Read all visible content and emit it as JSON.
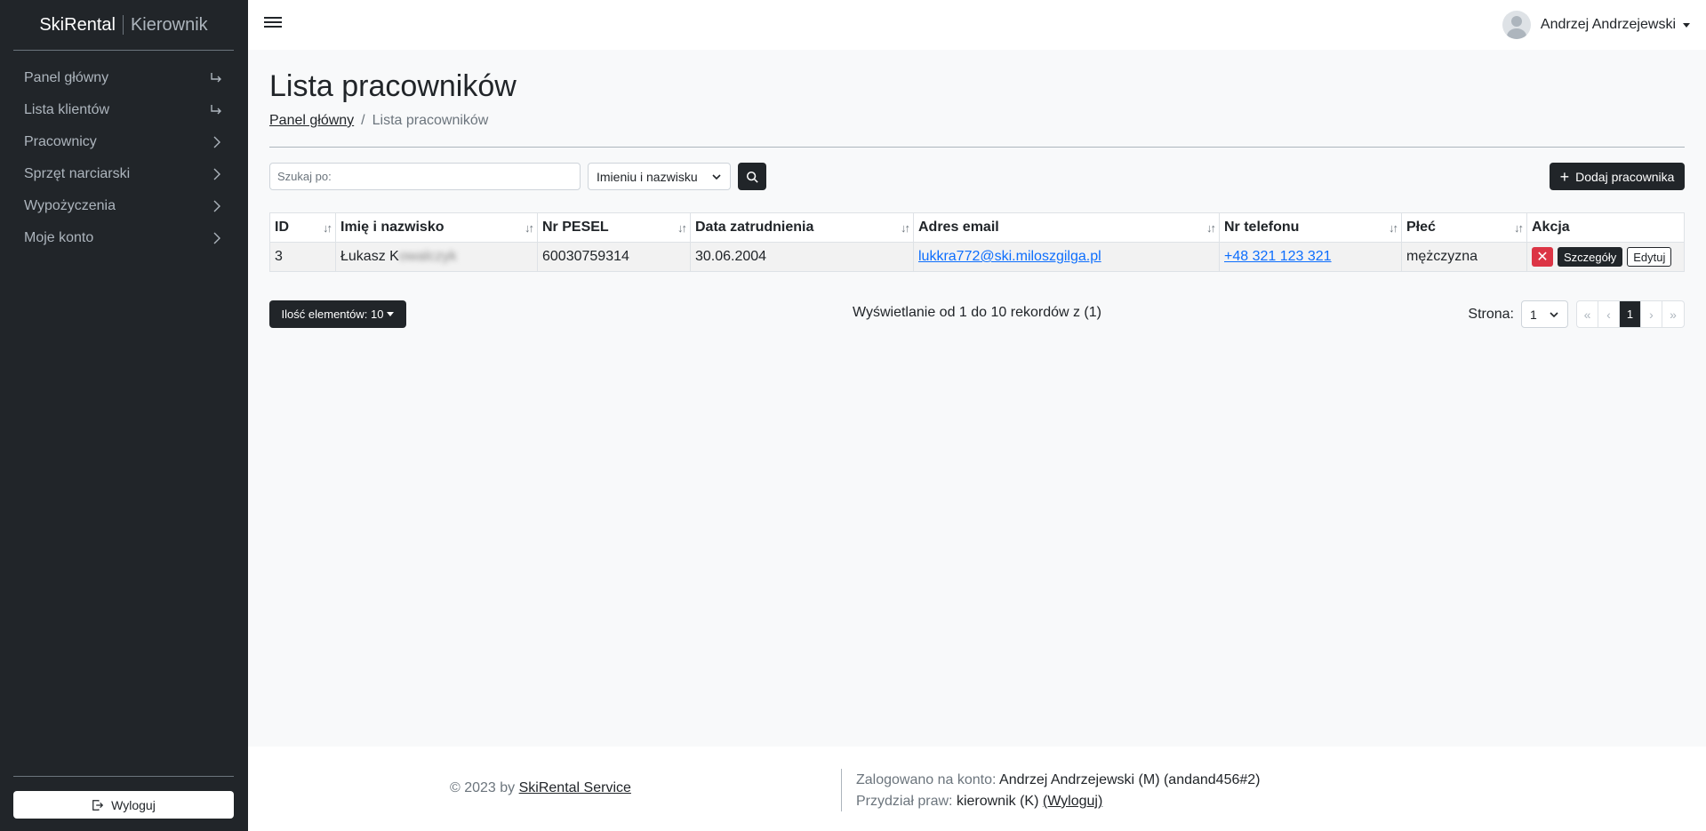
{
  "brand": {
    "name": "SkiRental",
    "role": "Kierownik"
  },
  "sidebar": {
    "items": [
      {
        "label": "Panel główny",
        "icon": "arrow-return-right-icon"
      },
      {
        "label": "Lista klientów",
        "icon": "arrow-return-right-icon"
      },
      {
        "label": "Pracownicy",
        "icon": "chevron-right-icon"
      },
      {
        "label": "Sprzęt narciarski",
        "icon": "chevron-right-icon"
      },
      {
        "label": "Wypożyczenia",
        "icon": "chevron-right-icon"
      },
      {
        "label": "Moje konto",
        "icon": "chevron-right-icon"
      }
    ],
    "logout_label": "Wyloguj"
  },
  "header": {
    "user_name": "Andrzej Andrzejewski"
  },
  "main": {
    "title": "Lista pracowników",
    "breadcrumb": {
      "home": "Panel główny",
      "current": "Lista pracowników"
    },
    "search": {
      "placeholder": "Szukaj po:",
      "value": ""
    },
    "search_by": "Imieniu i nazwisku",
    "add_label": "Dodaj pracownika",
    "table": {
      "columns": [
        "ID",
        "Imię i nazwisko",
        "Nr PESEL",
        "Data zatrudnienia",
        "Adres email",
        "Nr telefonu",
        "Płeć",
        "Akcja"
      ],
      "rows": [
        {
          "id": "3",
          "name_visible": "Łukasz K",
          "name_blurred": "owalczyk",
          "pesel": "60030759314",
          "hire_date": "30.06.2004",
          "email": "lukkra772@ski.miloszgilga.pl",
          "phone": "+48 321 123 321",
          "gender": "mężczyzna"
        }
      ],
      "actions": {
        "delete": "✕",
        "details": "Szczegóły",
        "edit": "Edytuj"
      }
    },
    "page_size_label": "Ilość elementów: 10",
    "showing": "Wyświetlanie od 1 do 10 rekordów z (1)",
    "pager": {
      "label": "Strona:",
      "page": "1",
      "first": "«",
      "prev": "‹",
      "current": "1",
      "next": "›",
      "last": "»"
    }
  },
  "footer": {
    "copyright": "© 2023 by",
    "company": "SkiRental Service",
    "logged_label": "Zalogowano na konto:",
    "logged_value": "Andrzej Andrzejewski (M) (andand456#2)",
    "rights_label": "Przydział praw:",
    "rights_value": "kierownik (K)",
    "logout_link": "(Wyloguj)"
  },
  "colors": {
    "sidebar": "#212529",
    "accent": "#212529",
    "danger": "#dc3545",
    "link": "#0d6efd"
  }
}
